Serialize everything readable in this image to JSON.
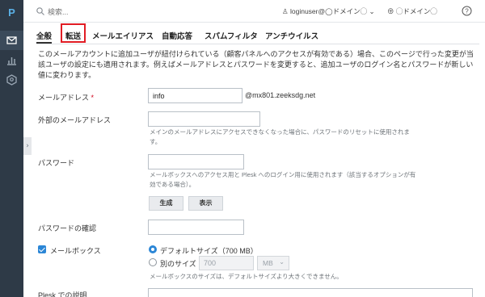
{
  "rail": {
    "logo": "P"
  },
  "topbar": {
    "search_placeholder": "検索...",
    "user": "loginuser@◯ドメイン◯",
    "domain": "◯ドメイン◯"
  },
  "tabs": [
    {
      "label": "全般",
      "active": true
    },
    {
      "label": "転送",
      "highlighted": true
    },
    {
      "label": "メールエイリアス"
    },
    {
      "label": "自動応答"
    },
    {
      "label": "スパムフィルタ"
    },
    {
      "label": "アンチウイルス"
    }
  ],
  "description": "このメールアカウントに追加ユーザが紐付けられている（顧客パネルへのアクセスが有効である）場合、このページで行った変更が当該ユーザの設定にも適用されます。例えばメールアドレスとパスワードを変更すると、追加ユーザのログイン名とパスワードが新しい値に変わります。",
  "form": {
    "email_label": "メールアドレス",
    "required_mark": "*",
    "email_value": "info",
    "email_domain": "@mx801.zeeksdg.net",
    "external_label": "外部のメールアドレス",
    "external_value": "",
    "external_hint": "メインのメールアドレスにアクセスできなくなった場合に、パスワードのリセットに使用されます。",
    "password_label": "パスワード",
    "password_value": "",
    "password_hint": "メールボックスへのアクセス用と Plesk へのログイン用に使用されます（該当するオプションが有効である場合）。",
    "generate_button": "生成",
    "show_button": "表示",
    "confirm_label": "パスワードの確認",
    "confirm_value": "",
    "mailbox_label": "メールボックス",
    "mailbox_checked": true,
    "size_default_label": "デフォルトサイズ（700 MB）",
    "size_other_label": "別のサイズ",
    "size_other_value": "700",
    "size_unit": "MB",
    "mailbox_hint": "メールボックスのサイズは、デフォルトサイズより大きくできません。",
    "plesk_desc_label": "Plesk での説明"
  },
  "colors": {
    "rail": "#2e3a47",
    "accent": "#2b86d6",
    "highlight": "#e11c24"
  }
}
